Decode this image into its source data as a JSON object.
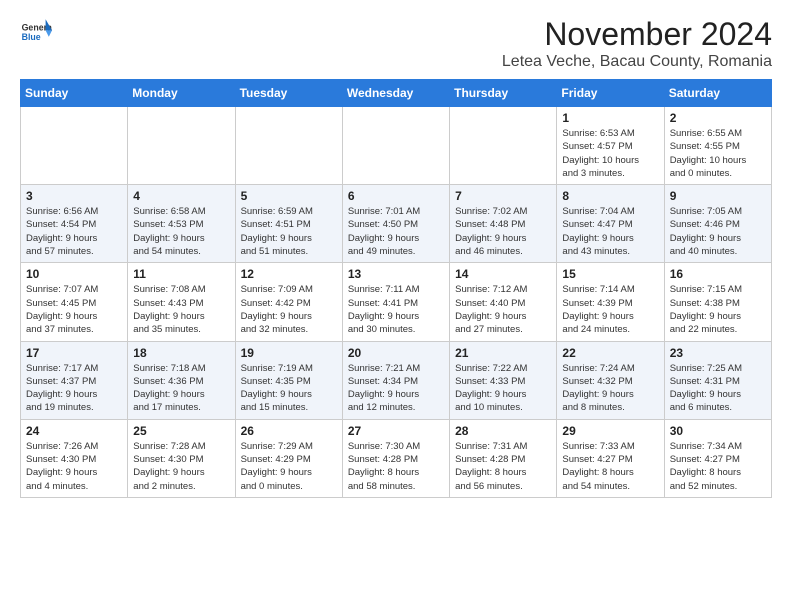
{
  "header": {
    "logo_general": "General",
    "logo_blue": "Blue",
    "month_year": "November 2024",
    "location": "Letea Veche, Bacau County, Romania"
  },
  "weekdays": [
    "Sunday",
    "Monday",
    "Tuesday",
    "Wednesday",
    "Thursday",
    "Friday",
    "Saturday"
  ],
  "weeks": [
    [
      {
        "day": "",
        "info": ""
      },
      {
        "day": "",
        "info": ""
      },
      {
        "day": "",
        "info": ""
      },
      {
        "day": "",
        "info": ""
      },
      {
        "day": "",
        "info": ""
      },
      {
        "day": "1",
        "info": "Sunrise: 6:53 AM\nSunset: 4:57 PM\nDaylight: 10 hours\nand 3 minutes."
      },
      {
        "day": "2",
        "info": "Sunrise: 6:55 AM\nSunset: 4:55 PM\nDaylight: 10 hours\nand 0 minutes."
      }
    ],
    [
      {
        "day": "3",
        "info": "Sunrise: 6:56 AM\nSunset: 4:54 PM\nDaylight: 9 hours\nand 57 minutes."
      },
      {
        "day": "4",
        "info": "Sunrise: 6:58 AM\nSunset: 4:53 PM\nDaylight: 9 hours\nand 54 minutes."
      },
      {
        "day": "5",
        "info": "Sunrise: 6:59 AM\nSunset: 4:51 PM\nDaylight: 9 hours\nand 51 minutes."
      },
      {
        "day": "6",
        "info": "Sunrise: 7:01 AM\nSunset: 4:50 PM\nDaylight: 9 hours\nand 49 minutes."
      },
      {
        "day": "7",
        "info": "Sunrise: 7:02 AM\nSunset: 4:48 PM\nDaylight: 9 hours\nand 46 minutes."
      },
      {
        "day": "8",
        "info": "Sunrise: 7:04 AM\nSunset: 4:47 PM\nDaylight: 9 hours\nand 43 minutes."
      },
      {
        "day": "9",
        "info": "Sunrise: 7:05 AM\nSunset: 4:46 PM\nDaylight: 9 hours\nand 40 minutes."
      }
    ],
    [
      {
        "day": "10",
        "info": "Sunrise: 7:07 AM\nSunset: 4:45 PM\nDaylight: 9 hours\nand 37 minutes."
      },
      {
        "day": "11",
        "info": "Sunrise: 7:08 AM\nSunset: 4:43 PM\nDaylight: 9 hours\nand 35 minutes."
      },
      {
        "day": "12",
        "info": "Sunrise: 7:09 AM\nSunset: 4:42 PM\nDaylight: 9 hours\nand 32 minutes."
      },
      {
        "day": "13",
        "info": "Sunrise: 7:11 AM\nSunset: 4:41 PM\nDaylight: 9 hours\nand 30 minutes."
      },
      {
        "day": "14",
        "info": "Sunrise: 7:12 AM\nSunset: 4:40 PM\nDaylight: 9 hours\nand 27 minutes."
      },
      {
        "day": "15",
        "info": "Sunrise: 7:14 AM\nSunset: 4:39 PM\nDaylight: 9 hours\nand 24 minutes."
      },
      {
        "day": "16",
        "info": "Sunrise: 7:15 AM\nSunset: 4:38 PM\nDaylight: 9 hours\nand 22 minutes."
      }
    ],
    [
      {
        "day": "17",
        "info": "Sunrise: 7:17 AM\nSunset: 4:37 PM\nDaylight: 9 hours\nand 19 minutes."
      },
      {
        "day": "18",
        "info": "Sunrise: 7:18 AM\nSunset: 4:36 PM\nDaylight: 9 hours\nand 17 minutes."
      },
      {
        "day": "19",
        "info": "Sunrise: 7:19 AM\nSunset: 4:35 PM\nDaylight: 9 hours\nand 15 minutes."
      },
      {
        "day": "20",
        "info": "Sunrise: 7:21 AM\nSunset: 4:34 PM\nDaylight: 9 hours\nand 12 minutes."
      },
      {
        "day": "21",
        "info": "Sunrise: 7:22 AM\nSunset: 4:33 PM\nDaylight: 9 hours\nand 10 minutes."
      },
      {
        "day": "22",
        "info": "Sunrise: 7:24 AM\nSunset: 4:32 PM\nDaylight: 9 hours\nand 8 minutes."
      },
      {
        "day": "23",
        "info": "Sunrise: 7:25 AM\nSunset: 4:31 PM\nDaylight: 9 hours\nand 6 minutes."
      }
    ],
    [
      {
        "day": "24",
        "info": "Sunrise: 7:26 AM\nSunset: 4:30 PM\nDaylight: 9 hours\nand 4 minutes."
      },
      {
        "day": "25",
        "info": "Sunrise: 7:28 AM\nSunset: 4:30 PM\nDaylight: 9 hours\nand 2 minutes."
      },
      {
        "day": "26",
        "info": "Sunrise: 7:29 AM\nSunset: 4:29 PM\nDaylight: 9 hours\nand 0 minutes."
      },
      {
        "day": "27",
        "info": "Sunrise: 7:30 AM\nSunset: 4:28 PM\nDaylight: 8 hours\nand 58 minutes."
      },
      {
        "day": "28",
        "info": "Sunrise: 7:31 AM\nSunset: 4:28 PM\nDaylight: 8 hours\nand 56 minutes."
      },
      {
        "day": "29",
        "info": "Sunrise: 7:33 AM\nSunset: 4:27 PM\nDaylight: 8 hours\nand 54 minutes."
      },
      {
        "day": "30",
        "info": "Sunrise: 7:34 AM\nSunset: 4:27 PM\nDaylight: 8 hours\nand 52 minutes."
      }
    ]
  ]
}
